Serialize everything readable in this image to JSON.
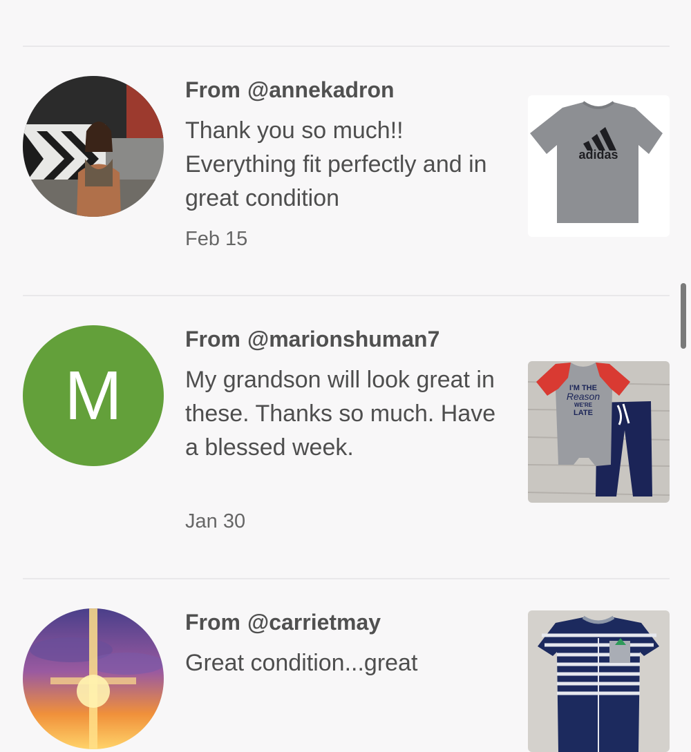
{
  "reviews": [
    {
      "from_label": "From",
      "username": "@annekadron",
      "message": "Thank you so much!! Everything fit perfectly and in great condition",
      "date": "Feb 15",
      "avatar_type": "photo-woman-train",
      "item_image": "gray-adidas-tshirt",
      "item_brand_text": "adidas"
    },
    {
      "from_label": "From",
      "username": "@marionshuman7",
      "avatar_letter": "M",
      "avatar_color": "#63a03a",
      "message": "My grandson will look great in these. Thanks so much. Have a blessed week.",
      "date": "Jan 30",
      "item_image": "baby-onesie-and-pants",
      "item_print_lines": [
        "I'M THE",
        "Reason",
        "WE'RE",
        "LATE"
      ]
    },
    {
      "from_label": "From",
      "username": "@carrietmay",
      "message": "Great condition...great",
      "avatar_type": "photo-sunset-cross",
      "item_image": "navy-striped-romper"
    }
  ],
  "colors": {
    "background": "#f8f7f8",
    "divider": "#e9e8ea",
    "text": "#505050",
    "avatar_green": "#63a03a"
  }
}
